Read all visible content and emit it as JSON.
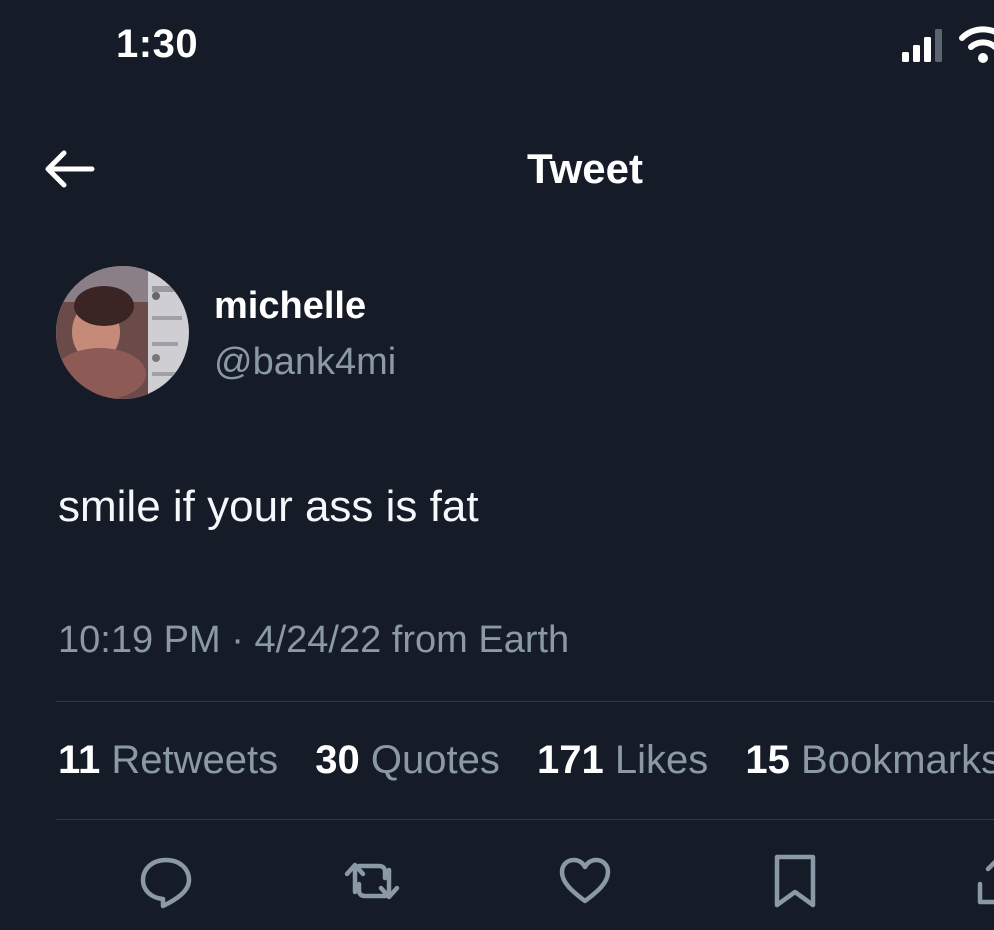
{
  "status_bar": {
    "time": "1:30"
  },
  "header": {
    "title": "Tweet"
  },
  "tweet": {
    "author": {
      "display_name": "michelle",
      "handle": "@bank4mi"
    },
    "text": "smile if your ass is fat",
    "time": "10:19 PM",
    "separator": "·",
    "date": "4/24/22",
    "source": "from Earth"
  },
  "stats": {
    "retweets": {
      "count": "11",
      "label": "Retweets"
    },
    "quotes": {
      "count": "30",
      "label": "Quotes"
    },
    "likes": {
      "count": "171",
      "label": "Likes"
    },
    "bookmarks": {
      "count": "15",
      "label": "Bookmarks"
    }
  },
  "actions": [
    "reply-icon",
    "retweet-icon",
    "like-icon",
    "bookmark-icon",
    "share-icon"
  ],
  "colors": {
    "background": "#151c28",
    "secondary_text": "#8b98a5",
    "primary_text": "#ffffff",
    "divider": "#2f3a47"
  }
}
